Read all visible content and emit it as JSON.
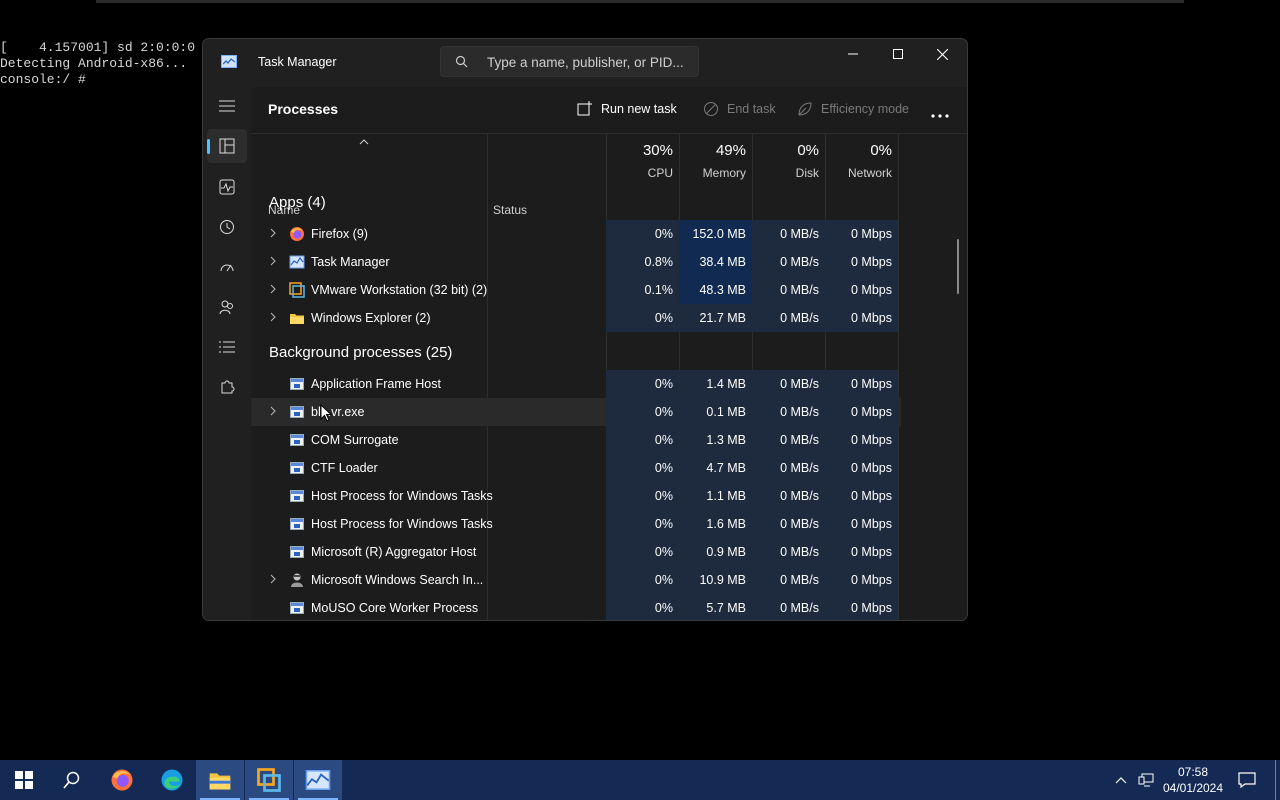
{
  "console": {
    "lines": [
      "[    4.157001] sd 2:0:0:0",
      "Detecting Android-x86...",
      "console:/ #"
    ]
  },
  "window": {
    "title": "Task Manager",
    "search_placeholder": "Type a name, publisher, or PID..."
  },
  "toolbar": {
    "page_title": "Processes",
    "run_new_task": "Run new task",
    "end_task": "End task",
    "efficiency_mode": "Efficiency mode"
  },
  "columns": {
    "name": "Name",
    "status": "Status",
    "cpu_pct": "30%",
    "cpu": "CPU",
    "mem_pct": "49%",
    "mem": "Memory",
    "disk_pct": "0%",
    "disk": "Disk",
    "net_pct": "0%",
    "net": "Network"
  },
  "groups": {
    "apps": "Apps (4)",
    "background": "Background processes (25)"
  },
  "apps": [
    {
      "name": "Firefox (9)",
      "cpu": "0%",
      "mem": "152.0 MB",
      "disk": "0 MB/s",
      "net": "0 Mbps",
      "icon": "firefox-icon"
    },
    {
      "name": "Task Manager",
      "cpu": "0.8%",
      "mem": "38.4 MB",
      "disk": "0 MB/s",
      "net": "0 Mbps",
      "icon": "task-manager-icon"
    },
    {
      "name": "VMware Workstation (32 bit) (2)",
      "cpu": "0.1%",
      "mem": "48.3 MB",
      "disk": "0 MB/s",
      "net": "0 Mbps",
      "icon": "vmware-icon"
    },
    {
      "name": "Windows Explorer (2)",
      "cpu": "0%",
      "mem": "21.7 MB",
      "disk": "0 MB/s",
      "net": "0 Mbps",
      "icon": "folder-icon"
    }
  ],
  "background": [
    {
      "name": "Application Frame Host",
      "cpu": "0%",
      "mem": "1.4 MB",
      "disk": "0 MB/s",
      "net": "0 Mbps"
    },
    {
      "name": "bl...vr.exe",
      "cpu": "0%",
      "mem": "0.1 MB",
      "disk": "0 MB/s",
      "net": "0 Mbps"
    },
    {
      "name": "COM Surrogate",
      "cpu": "0%",
      "mem": "1.3 MB",
      "disk": "0 MB/s",
      "net": "0 Mbps"
    },
    {
      "name": "CTF Loader",
      "cpu": "0%",
      "mem": "4.7 MB",
      "disk": "0 MB/s",
      "net": "0 Mbps"
    },
    {
      "name": "Host Process for Windows Tasks",
      "cpu": "0%",
      "mem": "1.1 MB",
      "disk": "0 MB/s",
      "net": "0 Mbps"
    },
    {
      "name": "Host Process for Windows Tasks",
      "cpu": "0%",
      "mem": "1.6 MB",
      "disk": "0 MB/s",
      "net": "0 Mbps"
    },
    {
      "name": "Microsoft (R) Aggregator Host",
      "cpu": "0%",
      "mem": "0.9 MB",
      "disk": "0 MB/s",
      "net": "0 Mbps"
    },
    {
      "name": "Microsoft Windows Search In...",
      "cpu": "0%",
      "mem": "10.9 MB",
      "disk": "0 MB/s",
      "net": "0 Mbps"
    },
    {
      "name": "MoUSO Core Worker Process",
      "cpu": "0%",
      "mem": "5.7 MB",
      "disk": "0 MB/s",
      "net": "0 Mbps"
    }
  ],
  "taskbar": {
    "time": "07:58",
    "date": "04/01/2024"
  },
  "colors": {
    "accent": "#4cc2ff",
    "taskbar": "#142a55",
    "heat_light": "#1e2a3d",
    "heat_dark": "#102a52"
  }
}
